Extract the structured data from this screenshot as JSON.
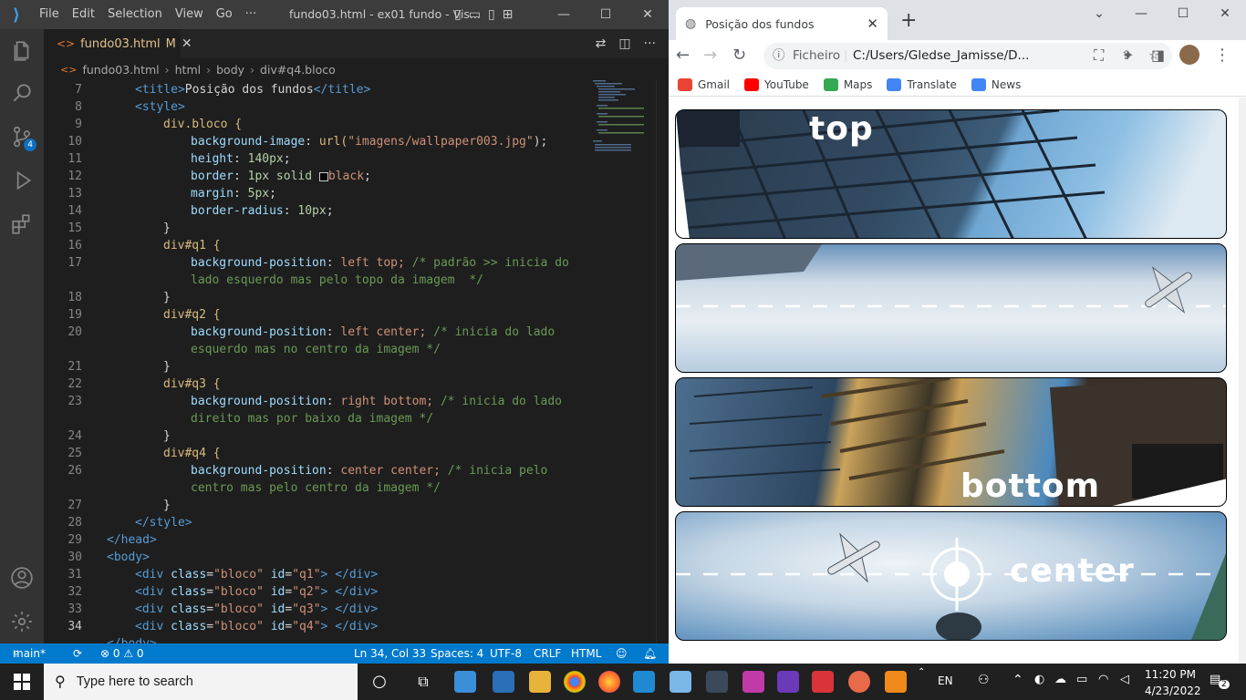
{
  "vscode": {
    "menu": [
      "File",
      "Edit",
      "Selection",
      "View",
      "Go",
      "···"
    ],
    "window_title": "fundo03.html - ex01 fundo - Vis...",
    "tab": {
      "label": "fundo03.html",
      "modified": "M",
      "close": "✕"
    },
    "breadcrumb": [
      "fundo03.html",
      "html",
      "body",
      "div#q4.bloco"
    ],
    "scm_badge": "4",
    "lines": [
      {
        "n": "7"
      },
      {
        "n": "8"
      },
      {
        "n": "9"
      },
      {
        "n": "10"
      },
      {
        "n": "11"
      },
      {
        "n": "12"
      },
      {
        "n": "13"
      },
      {
        "n": "14"
      },
      {
        "n": "15"
      },
      {
        "n": "16"
      },
      {
        "n": "17"
      },
      {
        "n": ""
      },
      {
        "n": "18"
      },
      {
        "n": "19"
      },
      {
        "n": "20"
      },
      {
        "n": ""
      },
      {
        "n": "21"
      },
      {
        "n": "22"
      },
      {
        "n": "23"
      },
      {
        "n": ""
      },
      {
        "n": "24"
      },
      {
        "n": "25"
      },
      {
        "n": "26"
      },
      {
        "n": ""
      },
      {
        "n": "27"
      },
      {
        "n": "28"
      },
      {
        "n": "29"
      },
      {
        "n": "30"
      },
      {
        "n": "31"
      },
      {
        "n": "32"
      },
      {
        "n": "33"
      },
      {
        "n": "34"
      },
      {
        "n": ""
      }
    ],
    "code": {
      "l7": [
        "<title>",
        "Posição dos fundos",
        "</title>"
      ],
      "l9": "div.bloco {",
      "l10": [
        "background-image",
        "url(",
        "\"imagens/wallpaper003.jpg\"",
        ");"
      ],
      "l11": [
        "height",
        "140px",
        ";"
      ],
      "l12": [
        "border",
        "1px solid",
        "black",
        ";"
      ],
      "l13": [
        "margin",
        "5px",
        ";"
      ],
      "l14": [
        "border-radius",
        "10px",
        ";"
      ],
      "q1_sel": "div#q1 {",
      "q1_prop": [
        "background-position",
        "left top;",
        "/* padrão >> inicia do",
        "lado esquerdo mas pelo topo da imagem  */"
      ],
      "q2_sel": "div#q2 {",
      "q2_prop": [
        "background-position",
        "left center;",
        "/* inicia do lado",
        "esquerdo mas no centro da imagem */"
      ],
      "q3_sel": "div#q3 {",
      "q3_prop": [
        "background-position",
        "right bottom;",
        "/* inicia do lado",
        "direito mas por baixo da imagem */"
      ],
      "q4_sel": "div#q4 {",
      "q4_prop": [
        "background-position",
        "center center;",
        "/* inicia pelo",
        "centro mas pelo centro da imagem */"
      ],
      "close_brace": "}",
      "style_open": "<style>",
      "style_close": "</style>",
      "head_close": "</head>",
      "body_open": "<body>",
      "divs": [
        "q1",
        "q2",
        "q3",
        "q4"
      ],
      "body_close": "</body>"
    },
    "status": {
      "branch": "main*",
      "problems": "⊗ 0 ⚠ 0",
      "cursor": "Ln 34, Col 33",
      "spaces": "Spaces: 4",
      "encoding": "UTF-8",
      "eol": "CRLF",
      "language": "HTML"
    }
  },
  "chrome": {
    "tab_title": "Posição dos fundos",
    "omnibox_label": "Ficheiro",
    "url": "C:/Users/Gledse_Jamisse/D...",
    "bookmarks": [
      {
        "label": "Gmail",
        "color": "#ea4335"
      },
      {
        "label": "YouTube",
        "color": "#ff0000"
      },
      {
        "label": "Maps",
        "color": "#34a853"
      },
      {
        "label": "Translate",
        "color": "#4285f4"
      },
      {
        "label": "News",
        "color": "#4285f4"
      }
    ],
    "blocks": [
      {
        "id": "q1",
        "label": "top"
      },
      {
        "id": "q2",
        "label": ""
      },
      {
        "id": "q3",
        "label": "bottom"
      },
      {
        "id": "q4",
        "label": "center"
      }
    ]
  },
  "taskbar": {
    "search_placeholder": "Type here to search",
    "lang": "EN",
    "time": "11:20 PM",
    "date": "4/23/2022",
    "notifications": "2"
  }
}
